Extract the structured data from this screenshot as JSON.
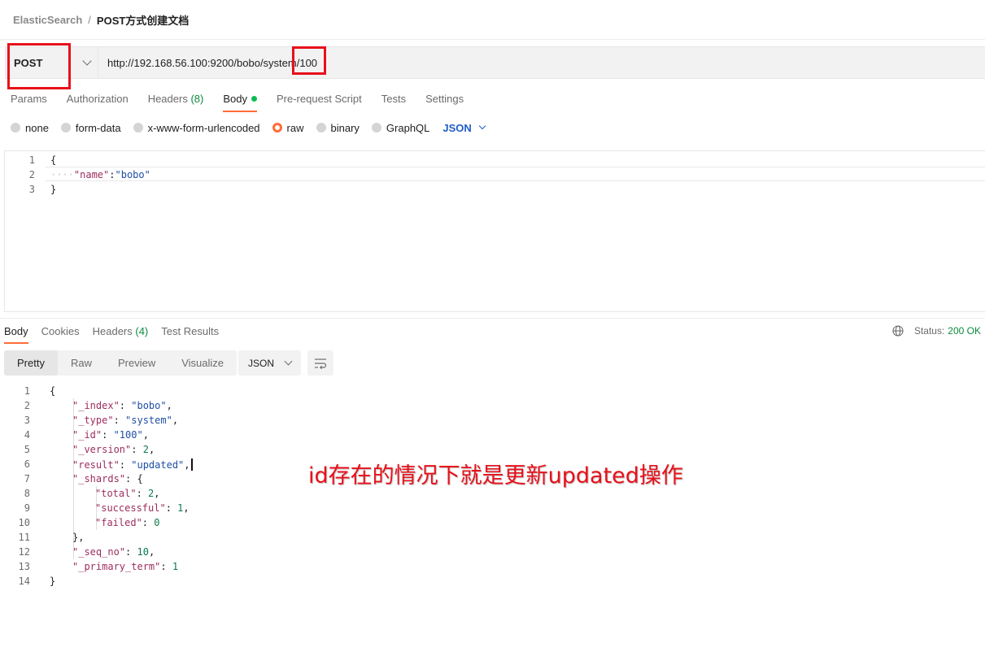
{
  "breadcrumb": {
    "parent": "ElasticSearch",
    "separator": "/",
    "current": "POST方式创建文档"
  },
  "request": {
    "method": "POST",
    "url": "http://192.168.56.100:9200/bobo/system/100"
  },
  "request_tabs": [
    {
      "label": "Params"
    },
    {
      "label": "Authorization"
    },
    {
      "label": "Headers",
      "count": "(8)"
    },
    {
      "label": "Body",
      "active": true
    },
    {
      "label": "Pre-request Script"
    },
    {
      "label": "Tests"
    },
    {
      "label": "Settings"
    }
  ],
  "body_types": [
    {
      "label": "none"
    },
    {
      "label": "form-data"
    },
    {
      "label": "x-www-form-urlencoded"
    },
    {
      "label": "raw",
      "checked": true
    },
    {
      "label": "binary"
    },
    {
      "label": "GraphQL"
    }
  ],
  "body_language": "JSON",
  "request_body": {
    "line_numbers": [
      "1",
      "2",
      "3"
    ],
    "open_brace": "{",
    "indent": "····",
    "key": "\"name\"",
    "colon": ":",
    "value": "\"bobo\"",
    "close_brace": "}"
  },
  "response_tabs": [
    {
      "label": "Body",
      "active": true
    },
    {
      "label": "Cookies"
    },
    {
      "label": "Headers",
      "count": "(4)"
    },
    {
      "label": "Test Results"
    }
  ],
  "status": {
    "label": "Status:",
    "value": "200 OK"
  },
  "view_modes": [
    "Pretty",
    "Raw",
    "Preview",
    "Visualize"
  ],
  "response_format": "JSON",
  "response_body": {
    "line_numbers": [
      "1",
      "2",
      "3",
      "4",
      "5",
      "6",
      "7",
      "8",
      "9",
      "10",
      "11",
      "12",
      "13",
      "14"
    ],
    "lines": [
      {
        "k": "{"
      },
      {
        "k": "\"_index\"",
        "v": "\"bobo\"",
        "t": "str",
        "end": ","
      },
      {
        "k": "\"_type\"",
        "v": "\"system\"",
        "t": "str",
        "end": ","
      },
      {
        "k": "\"_id\"",
        "v": "\"100\"",
        "t": "str",
        "end": ","
      },
      {
        "k": "\"_version\"",
        "v": "2",
        "t": "num",
        "end": ","
      },
      {
        "k": "\"result\"",
        "v": "\"updated\"",
        "t": "str",
        "end": ","
      },
      {
        "k": "\"_shards\"",
        "v": "{",
        "t": "brace",
        "end": ""
      },
      {
        "k": "\"total\"",
        "v": "2",
        "t": "num",
        "end": ","
      },
      {
        "k": "\"successful\"",
        "v": "1",
        "t": "num",
        "end": ","
      },
      {
        "k": "\"failed\"",
        "v": "0",
        "t": "num",
        "end": ""
      },
      {
        "k": "},",
        "t": "close"
      },
      {
        "k": "\"_seq_no\"",
        "v": "10",
        "t": "num",
        "end": ","
      },
      {
        "k": "\"_primary_term\"",
        "v": "1",
        "t": "num",
        "end": ""
      },
      {
        "k": "}"
      }
    ]
  },
  "annotation": "id存在的情况下就是更新updated操作",
  "colors": {
    "accent": "#ff6c37",
    "highlight": "#e8101a",
    "success": "#0b8a3e",
    "link": "#1f5dc6"
  }
}
